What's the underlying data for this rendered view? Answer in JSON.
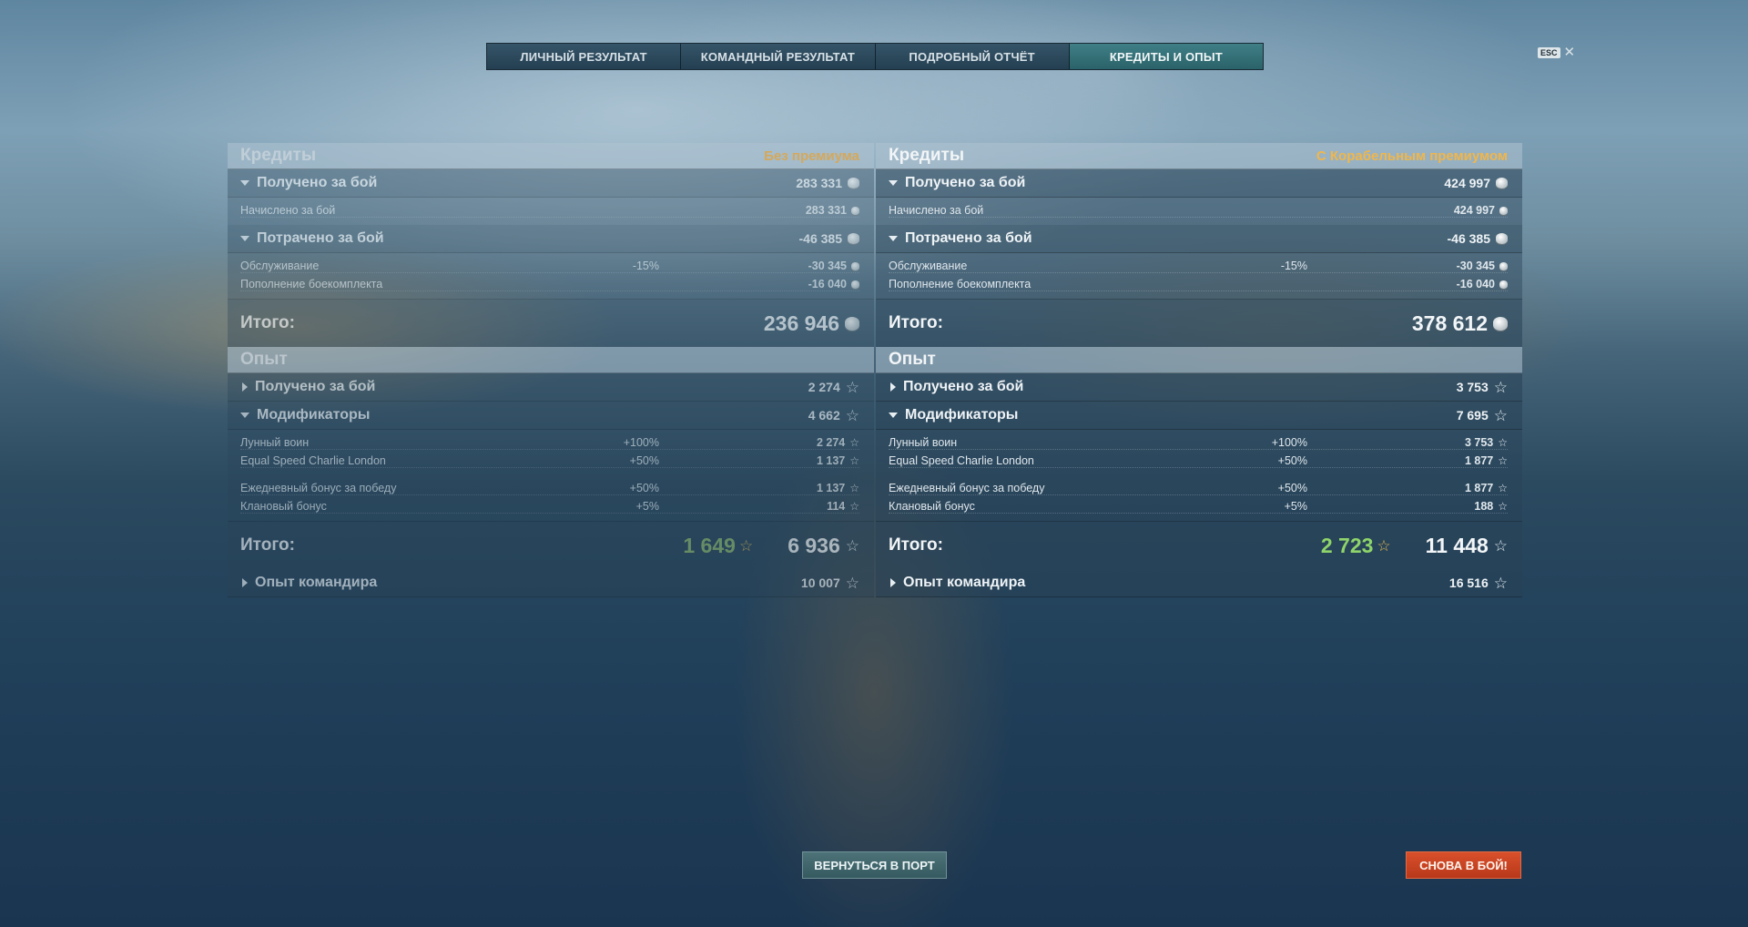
{
  "tabs": [
    {
      "label": "ЛИЧНЫЙ РЕЗУЛЬТАТ"
    },
    {
      "label": "КОМАНДНЫЙ РЕЗУЛЬТАТ"
    },
    {
      "label": "ПОДРОБНЫЙ ОТЧЁТ"
    },
    {
      "label": "КРЕДИТЫ И ОПЫТ"
    }
  ],
  "active_tab": "КРЕДИТЫ И ОПЫТ",
  "esc_label": "ESC",
  "close_symbol": "✕",
  "left": {
    "credits_title": "Кредиты",
    "premium_label": "Без премиума",
    "earned_label": "Получено за бой",
    "earned_value": "283 331",
    "accrued_label": "Начислено за бой",
    "accrued_value": "283 331",
    "spent_label": "Потрачено за бой",
    "spent_value": "-46 385",
    "service_label": "Обслуживание",
    "service_pct": "-15%",
    "service_value": "-30 345",
    "ammo_label": "Пополнение боекомплекта",
    "ammo_value": "-16 040",
    "total_label": "Итого:",
    "credits_total": "236 946",
    "xp_title": "Опыт",
    "xp_earned_label": "Получено за бой",
    "xp_earned_value": "2 274",
    "modifiers_label": "Модификаторы",
    "modifiers_value": "4 662",
    "mod1_label": "Лунный воин",
    "mod1_pct": "+100%",
    "mod1_value": "2 274",
    "mod2_label": "Equal Speed Charlie London",
    "mod2_pct": "+50%",
    "mod2_value": "1 137",
    "mod3_label": "Ежедневный бонус за победу",
    "mod3_pct": "+50%",
    "mod3_value": "1 137",
    "mod4_label": "Клановый бонус",
    "mod4_pct": "+5%",
    "mod4_value": "114",
    "xp_total_free": "1 649",
    "xp_total": "6 936",
    "commander_label": "Опыт командира",
    "commander_value": "10 007"
  },
  "right": {
    "credits_title": "Кредиты",
    "premium_label": "С Корабельным премиумом",
    "earned_label": "Получено за бой",
    "earned_value": "424 997",
    "accrued_label": "Начислено за бой",
    "accrued_value": "424 997",
    "spent_label": "Потрачено за бой",
    "spent_value": "-46 385",
    "service_label": "Обслуживание",
    "service_pct": "-15%",
    "service_value": "-30 345",
    "ammo_label": "Пополнение боекомплекта",
    "ammo_value": "-16 040",
    "total_label": "Итого:",
    "credits_total": "378 612",
    "xp_title": "Опыт",
    "xp_earned_label": "Получено за бой",
    "xp_earned_value": "3 753",
    "modifiers_label": "Модификаторы",
    "modifiers_value": "7 695",
    "mod1_label": "Лунный воин",
    "mod1_pct": "+100%",
    "mod1_value": "3 753",
    "mod2_label": "Equal Speed Charlie London",
    "mod2_pct": "+50%",
    "mod2_value": "1 877",
    "mod3_label": "Ежедневный бонус за победу",
    "mod3_pct": "+50%",
    "mod3_value": "1 877",
    "mod4_label": "Клановый бонус",
    "mod4_pct": "+5%",
    "mod4_value": "188",
    "xp_total_free": "2 723",
    "xp_total": "11 448",
    "commander_label": "Опыт командира",
    "commander_value": "16 516"
  },
  "buttons": {
    "return_port": "ВЕРНУТЬСЯ В ПОРТ",
    "battle_again": "СНОВА В БОЙ!"
  },
  "colors": {
    "premium": "#f0b64a",
    "free_xp": "#8fd46a",
    "battle_button": "#c9431f",
    "active_tab": "#357178"
  },
  "icons": [
    "credits-coin-icon",
    "xp-star-icon",
    "free-xp-star-icon",
    "expand-triangle-icon",
    "collapse-triangle-icon",
    "close-icon"
  ]
}
